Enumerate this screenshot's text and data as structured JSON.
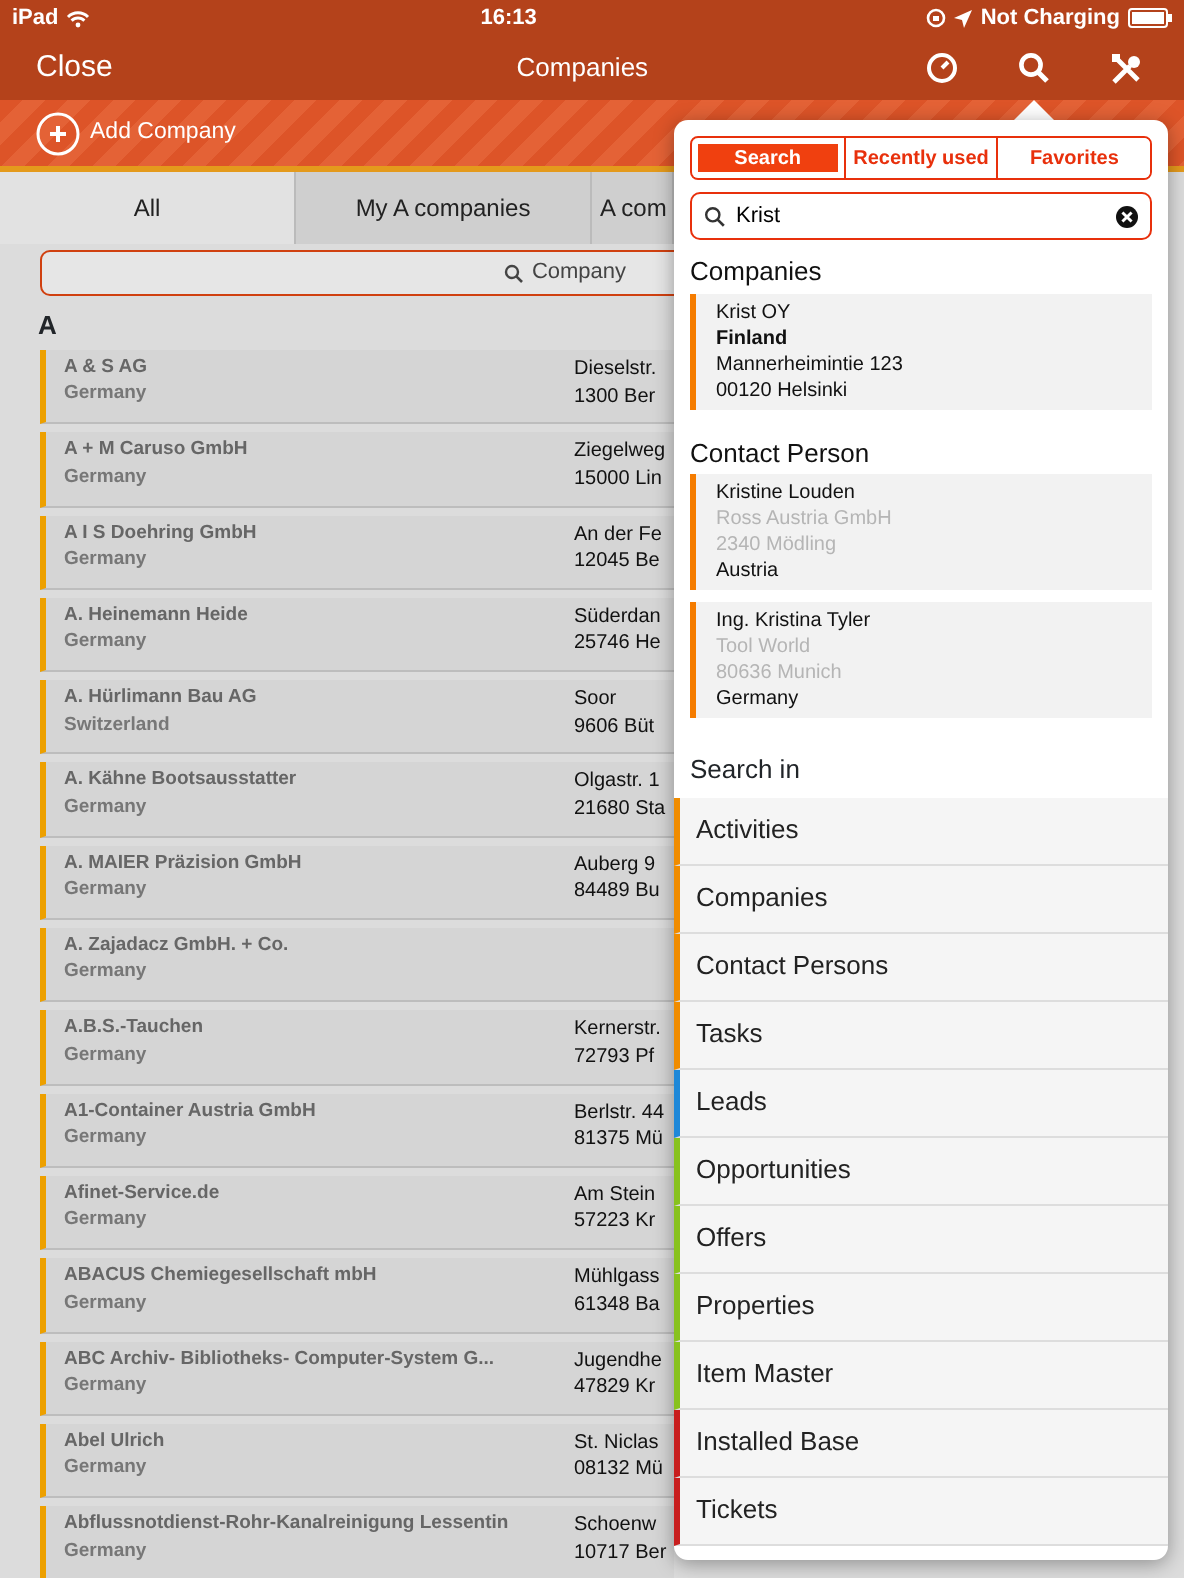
{
  "status_bar": {
    "device": "iPad",
    "time": "16:13",
    "charging": "Not Charging"
  },
  "nav": {
    "left_button": "Close",
    "title": "Companies"
  },
  "toolbar": {
    "add_button": "Add Company"
  },
  "tabs": [
    {
      "label": "All",
      "selected": true
    },
    {
      "label": "My A companies",
      "selected": false
    },
    {
      "label": "A com",
      "selected": false
    }
  ],
  "search": {
    "placeholder": "Company"
  },
  "list": {
    "section": "A",
    "rows": [
      {
        "name": "A & S AG",
        "country": "Germany",
        "street": "Dieselstr.",
        "city": "1300 Ber"
      },
      {
        "name": "A + M Caruso GmbH",
        "country": "Germany",
        "street": "Ziegelweg",
        "city": "15000 Lin"
      },
      {
        "name": "A I S Doehring GmbH",
        "country": "Germany",
        "street": "An der Fe",
        "city": "12045 Be"
      },
      {
        "name": "A. Heinemann Heide",
        "country": "Germany",
        "street": "Süderdan",
        "city": "25746 He"
      },
      {
        "name": "A. Hürlimann Bau AG",
        "country": "Switzerland",
        "street": "Soor",
        "city": "9606 Büt"
      },
      {
        "name": "A. Kähne Bootsausstatter",
        "country": "Germany",
        "street": "Olgastr. 1",
        "city": "21680 Sta"
      },
      {
        "name": "A. MAIER Präzision GmbH",
        "country": "Germany",
        "street": "Auberg 9",
        "city": "84489 Bu"
      },
      {
        "name": "A. Zajadacz GmbH. + Co.",
        "country": "Germany"
      },
      {
        "name": "A.B.S.-Tauchen",
        "country": "Germany",
        "street": "Kernerstr.",
        "city": "72793 Pf"
      },
      {
        "name": "A1-Container Austria GmbH",
        "country": "Germany",
        "street": "Berlstr. 44",
        "city": "81375 Mü"
      },
      {
        "name": "Afinet-Service.de",
        "country": "Germany",
        "street": "Am Stein",
        "city": "57223 Kr"
      },
      {
        "name": "ABACUS Chemiegesellschaft mbH",
        "country": "Germany",
        "street": "Mühlgass",
        "city": "61348 Ba"
      },
      {
        "name": "ABC Archiv- Bibliotheks- Computer-System G...",
        "country": "Germany",
        "street": "Jugendhe",
        "city": "47829 Kr"
      },
      {
        "name": "Abel Ulrich",
        "country": "Germany",
        "street": "St. Niclas",
        "city": "08132 Mü"
      },
      {
        "name": "Abflussnotdienst-Rohr-Kanalreinigung Lessentin",
        "country": "Germany",
        "street": "Schoenw",
        "city": "10717 Ber"
      }
    ]
  },
  "popover": {
    "segments": [
      {
        "label": "Search",
        "selected": true
      },
      {
        "label": "Recently used",
        "selected": false
      },
      {
        "label": "Favorites",
        "selected": false
      }
    ],
    "search_value": "Krist",
    "groups": [
      {
        "title": "Companies",
        "results": [
          {
            "lines": [
              {
                "text": "Krist OY",
                "kind": "plain"
              },
              {
                "text": "Finland",
                "kind": "bold"
              },
              {
                "text": "Mannerheimintie 123",
                "kind": "plain"
              },
              {
                "text": "00120 Helsinki",
                "kind": "plain"
              }
            ]
          }
        ]
      },
      {
        "title": "Contact Person",
        "results": [
          {
            "lines": [
              {
                "text": "Kristine Louden",
                "kind": "plain"
              },
              {
                "text": "Ross Austria GmbH",
                "kind": "muted"
              },
              {
                "text": "2340 Mödling",
                "kind": "muted"
              },
              {
                "text": "Austria",
                "kind": "plain"
              }
            ]
          },
          {
            "lines": [
              {
                "text": "Ing. Kristina Tyler",
                "kind": "plain"
              },
              {
                "text": "Tool World",
                "kind": "muted"
              },
              {
                "text": "80636 Munich",
                "kind": "muted"
              },
              {
                "text": "Germany",
                "kind": "plain"
              }
            ]
          }
        ]
      }
    ],
    "search_in_title": "Search in",
    "search_in": [
      {
        "label": "Activities",
        "color": "#f08c00"
      },
      {
        "label": "Companies",
        "color": "#f08c00"
      },
      {
        "label": "Contact Persons",
        "color": "#f08c00"
      },
      {
        "label": "Tasks",
        "color": "#f08c00"
      },
      {
        "label": "Leads",
        "color": "#1e88d8"
      },
      {
        "label": "Opportunities",
        "color": "#88c21e"
      },
      {
        "label": "Offers",
        "color": "#88c21e"
      },
      {
        "label": "Properties",
        "color": "#88c21e"
      },
      {
        "label": "Item Master",
        "color": "#88c21e"
      },
      {
        "label": "Installed Base",
        "color": "#c81e1e"
      },
      {
        "label": "Tickets",
        "color": "#c81e1e"
      }
    ]
  }
}
